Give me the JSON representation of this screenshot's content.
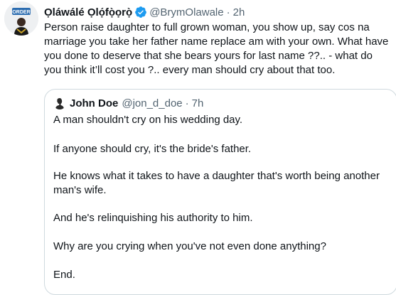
{
  "tweet": {
    "author_name": "Ọláwálé Ọlọ́fọ̀ọrọ̀",
    "handle": "@BrymOlawale",
    "dot": "·",
    "time": "2h",
    "text": "Person raise daughter to full grown woman, you show up, say cos na marriage you take her father name replace am with your own. What have you done to deserve that she bears yours for last name ??.. - what do you think it’ll cost you ?.. every man should cry about that too.",
    "avatar_badge": "ORDER",
    "colors": {
      "verified": "#1d9bf0",
      "secondary_text": "#536471",
      "border": "#cfd9de"
    }
  },
  "quote": {
    "author_name": "John Doe",
    "handle": "@jon_d_doe",
    "dot": "·",
    "time": "7h",
    "paragraphs": [
      "A man shouldn't cry on his wedding day.",
      "If anyone should cry, it's the bride's father.",
      "He knows what it takes to have a daughter that's worth being another man's wife.",
      "And he's relinquishing his authority to him.",
      "Why are you crying when you've not even done anything?",
      "End."
    ]
  }
}
